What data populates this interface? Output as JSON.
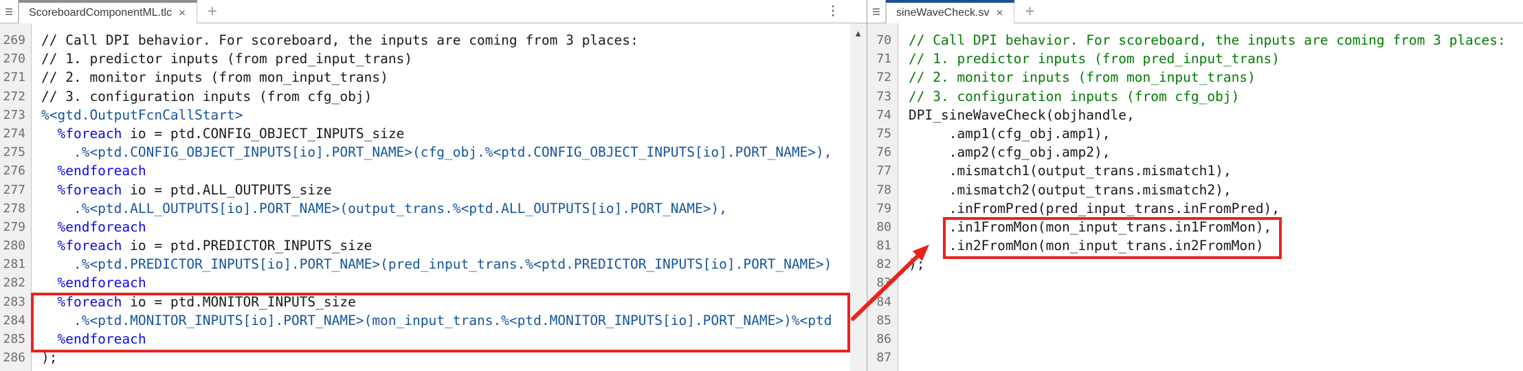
{
  "colors": {
    "annotation": "#e8231d",
    "comment": "#007c00",
    "keyword": "#0a0ae6",
    "directive": "#16559c",
    "tab-accent-left": "#8f8f8f",
    "tab-accent-right": "#1c4f8f"
  },
  "icons": {
    "new_tab": "+",
    "kebab_menu": "⋮",
    "scroll_up": "▲",
    "tab_close": "×"
  },
  "panes": [
    {
      "tab": {
        "title": "ScoreboardComponentML.tlc"
      },
      "lines": [
        {
          "num": "269",
          "seg": [
            {
              "t": "// Call DPI behavior. For scoreboard, the inputs are coming from 3 places:",
              "c": "t"
            }
          ]
        },
        {
          "num": "270",
          "seg": [
            {
              "t": "// 1. predictor inputs (from pred_input_trans)",
              "c": "t"
            }
          ]
        },
        {
          "num": "271",
          "seg": [
            {
              "t": "// 2. monitor inputs (from mon_input_trans)",
              "c": "t"
            }
          ]
        },
        {
          "num": "272",
          "seg": [
            {
              "t": "// 3. configuration inputs (from cfg_obj)",
              "c": "t"
            }
          ]
        },
        {
          "num": "273",
          "seg": [
            {
              "t": "%<gtd.OutputFcnCallStart>",
              "c": "d"
            }
          ]
        },
        {
          "num": "274",
          "seg": [
            {
              "t": "  ",
              "c": "t"
            },
            {
              "t": "%foreach",
              "c": "k"
            },
            {
              "t": " io = ptd.CONFIG_OBJECT_INPUTS_size",
              "c": "t"
            }
          ]
        },
        {
          "num": "275",
          "seg": [
            {
              "t": "    .%<ptd.CONFIG_OBJECT_INPUTS[io].PORT_NAME>(cfg_obj.%<ptd.CONFIG_OBJECT_INPUTS[io].PORT_NAME>),",
              "c": "d"
            }
          ]
        },
        {
          "num": "276",
          "seg": [
            {
              "t": "  ",
              "c": "t"
            },
            {
              "t": "%endforeach",
              "c": "k"
            }
          ]
        },
        {
          "num": "277",
          "seg": [
            {
              "t": "  ",
              "c": "t"
            },
            {
              "t": "%foreach",
              "c": "k"
            },
            {
              "t": " io = ptd.ALL_OUTPUTS_size",
              "c": "t"
            }
          ]
        },
        {
          "num": "278",
          "seg": [
            {
              "t": "    .%<ptd.ALL_OUTPUTS[io].PORT_NAME>(output_trans.%<ptd.ALL_OUTPUTS[io].PORT_NAME>),",
              "c": "d"
            }
          ]
        },
        {
          "num": "279",
          "seg": [
            {
              "t": "  ",
              "c": "t"
            },
            {
              "t": "%endforeach",
              "c": "k"
            }
          ]
        },
        {
          "num": "280",
          "seg": [
            {
              "t": "  ",
              "c": "t"
            },
            {
              "t": "%foreach",
              "c": "k"
            },
            {
              "t": " io = ptd.PREDICTOR_INPUTS_size",
              "c": "t"
            }
          ]
        },
        {
          "num": "281",
          "seg": [
            {
              "t": "    .%<ptd.PREDICTOR_INPUTS[io].PORT_NAME>(pred_input_trans.%<ptd.PREDICTOR_INPUTS[io].PORT_NAME>)",
              "c": "d"
            }
          ]
        },
        {
          "num": "282",
          "seg": [
            {
              "t": "  ",
              "c": "t"
            },
            {
              "t": "%endforeach",
              "c": "k"
            }
          ]
        },
        {
          "num": "283",
          "seg": [
            {
              "t": "  ",
              "c": "t"
            },
            {
              "t": "%foreach",
              "c": "k"
            },
            {
              "t": " io = ptd.MONITOR_INPUTS_size",
              "c": "t"
            }
          ]
        },
        {
          "num": "284",
          "seg": [
            {
              "t": "    .%<ptd.MONITOR_INPUTS[io].PORT_NAME>(mon_input_trans.%<ptd.MONITOR_INPUTS[io].PORT_NAME>)%<ptd",
              "c": "d"
            }
          ]
        },
        {
          "num": "285",
          "seg": [
            {
              "t": "  ",
              "c": "t"
            },
            {
              "t": "%endforeach",
              "c": "k"
            }
          ]
        },
        {
          "num": "286",
          "seg": [
            {
              "t": ");",
              "c": "t"
            }
          ]
        }
      ]
    },
    {
      "tab": {
        "title": "sineWaveCheck.sv"
      },
      "lines": [
        {
          "num": "70",
          "seg": [
            {
              "t": "// Call DPI behavior. For scoreboard, the inputs are coming from 3 places:",
              "c": "c"
            }
          ]
        },
        {
          "num": "71",
          "seg": [
            {
              "t": "// 1. predictor inputs (from pred_input_trans)",
              "c": "c"
            }
          ]
        },
        {
          "num": "72",
          "seg": [
            {
              "t": "// 2. monitor inputs (from mon_input_trans)",
              "c": "c"
            }
          ]
        },
        {
          "num": "73",
          "seg": [
            {
              "t": "// 3. configuration inputs (from cfg_obj)",
              "c": "c"
            }
          ]
        },
        {
          "num": "74",
          "seg": [
            {
              "t": "DPI_sineWaveCheck(objhandle,",
              "c": "t"
            }
          ]
        },
        {
          "num": "75",
          "seg": [
            {
              "t": "     .amp1(cfg_obj.amp1),",
              "c": "t"
            }
          ]
        },
        {
          "num": "76",
          "seg": [
            {
              "t": "     .amp2(cfg_obj.amp2),",
              "c": "t"
            }
          ]
        },
        {
          "num": "77",
          "seg": [
            {
              "t": "     .mismatch1(output_trans.mismatch1),",
              "c": "t"
            }
          ]
        },
        {
          "num": "78",
          "seg": [
            {
              "t": "     .mismatch2(output_trans.mismatch2),",
              "c": "t"
            }
          ]
        },
        {
          "num": "79",
          "seg": [
            {
              "t": "     .inFromPred(pred_input_trans.inFromPred),",
              "c": "t"
            }
          ]
        },
        {
          "num": "80",
          "seg": [
            {
              "t": "     .in1FromMon(mon_input_trans.in1FromMon),",
              "c": "t"
            }
          ]
        },
        {
          "num": "81",
          "seg": [
            {
              "t": "     .in2FromMon(mon_input_trans.in2FromMon)",
              "c": "t"
            }
          ]
        },
        {
          "num": "82",
          "seg": [
            {
              "t": ");",
              "c": "t"
            }
          ]
        },
        {
          "num": "83",
          "seg": []
        },
        {
          "num": "84",
          "seg": []
        },
        {
          "num": "85",
          "seg": []
        },
        {
          "num": "86",
          "seg": []
        },
        {
          "num": "87",
          "seg": []
        }
      ]
    }
  ]
}
